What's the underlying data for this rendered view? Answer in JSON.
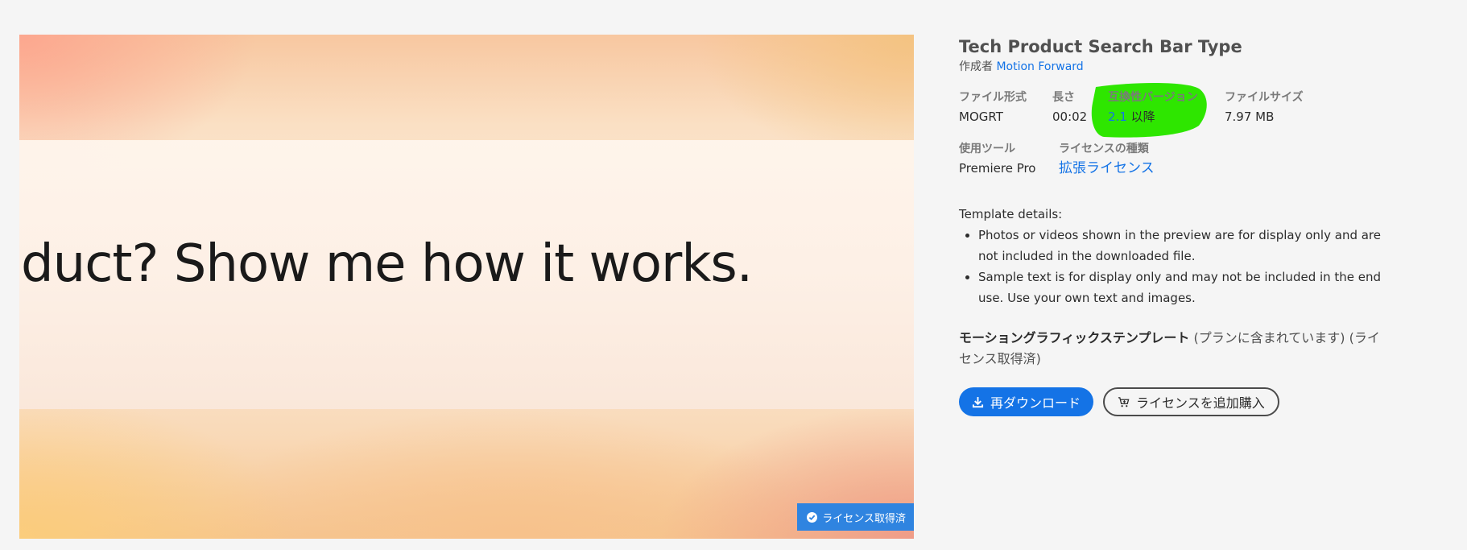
{
  "preview": {
    "caption": "duct? Show me how it works.",
    "badge_label": "ライセンス取得済",
    "badge_icon": "check-circle-icon"
  },
  "product": {
    "title": "Tech Product Search Bar Type",
    "author_prefix": "作成者",
    "author_name": "Motion Forward"
  },
  "meta": {
    "format_label": "ファイル形式",
    "format_value": "MOGRT",
    "duration_label": "長さ",
    "duration_value": "00:02",
    "compat_label": "互換性バージョン",
    "compat_version": "2.1",
    "compat_suffix": "以降",
    "size_label": "ファイルサイズ",
    "size_value": "7.97 MB",
    "tool_label": "使用ツール",
    "tool_value": "Premiere Pro",
    "license_type_label": "ライセンスの種類",
    "license_type_value": "拡張ライセンス"
  },
  "template_details": {
    "heading": "Template details:",
    "items": [
      "Photos or videos shown in the preview are for display only and are not included in the downloaded file.",
      "Sample text is for display only and may not be included in the end use. Use your own text and images."
    ]
  },
  "plan": {
    "type_bold": "モーショングラフィックステンプレート",
    "status_text": " (プランに含まれています) (ライセンス取得済)"
  },
  "actions": {
    "redownload_label": "再ダウンロード",
    "redownload_icon": "download-icon",
    "buy_license_label": "ライセンスを追加購入",
    "buy_license_icon": "cart-plus-icon"
  },
  "colors": {
    "accent": "#1473e6",
    "badge": "#2f84e0",
    "highlight_marker": "#2ee600"
  }
}
